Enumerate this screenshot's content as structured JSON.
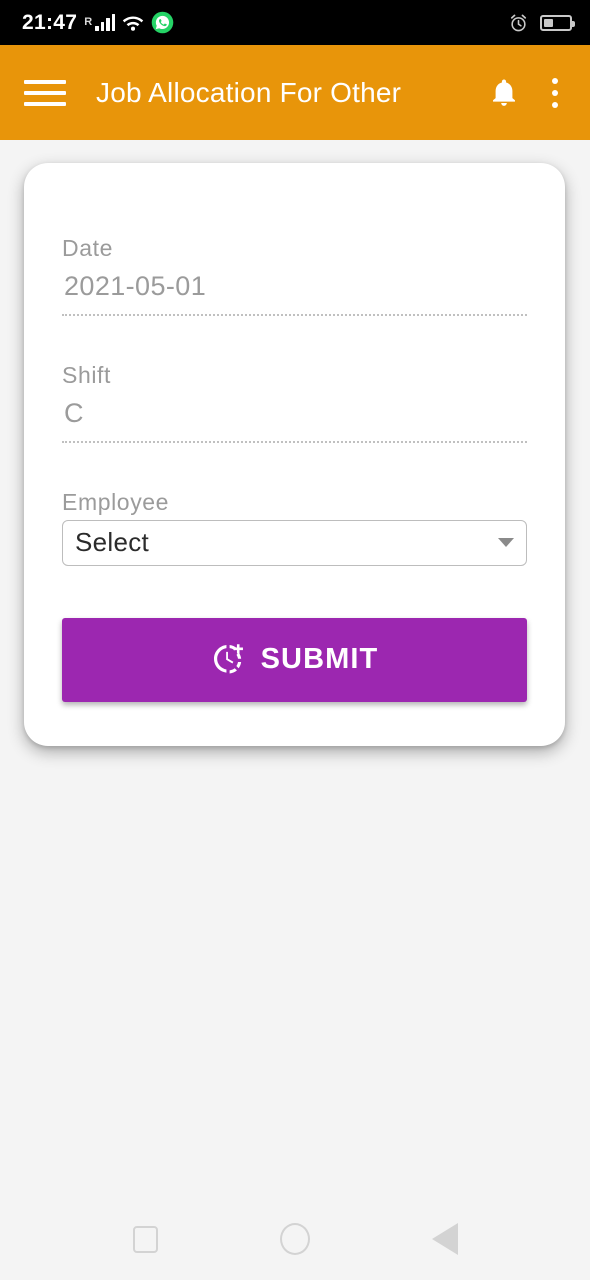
{
  "status_bar": {
    "time": "21:47",
    "roaming_indicator": "R",
    "icons": [
      "signal-bars-icon",
      "wifi-icon",
      "whatsapp-icon",
      "alarm-icon",
      "battery-icon"
    ],
    "battery_level_percent": 38
  },
  "app_bar": {
    "menu_icon": "hamburger-menu-icon",
    "title": "Job Allocation For Other",
    "notification_icon": "bell-icon",
    "overflow_icon": "more-vert-icon",
    "background_color": "#e8950a",
    "text_color": "#ffffff"
  },
  "form": {
    "fields": [
      {
        "label": "Date",
        "value": "2021-05-01",
        "type": "disabled-text"
      },
      {
        "label": "Shift",
        "value": "C",
        "type": "disabled-text"
      },
      {
        "label": "Employee",
        "value": "Select",
        "type": "dropdown"
      }
    ],
    "submit": {
      "label": "SUBMIT",
      "icon": "more-time-icon",
      "color": "#9c27b0"
    }
  },
  "nav_bar": {
    "buttons": [
      {
        "name": "recents",
        "icon": "square-icon"
      },
      {
        "name": "home",
        "icon": "circle-icon"
      },
      {
        "name": "back",
        "icon": "triangle-left-icon"
      }
    ]
  }
}
